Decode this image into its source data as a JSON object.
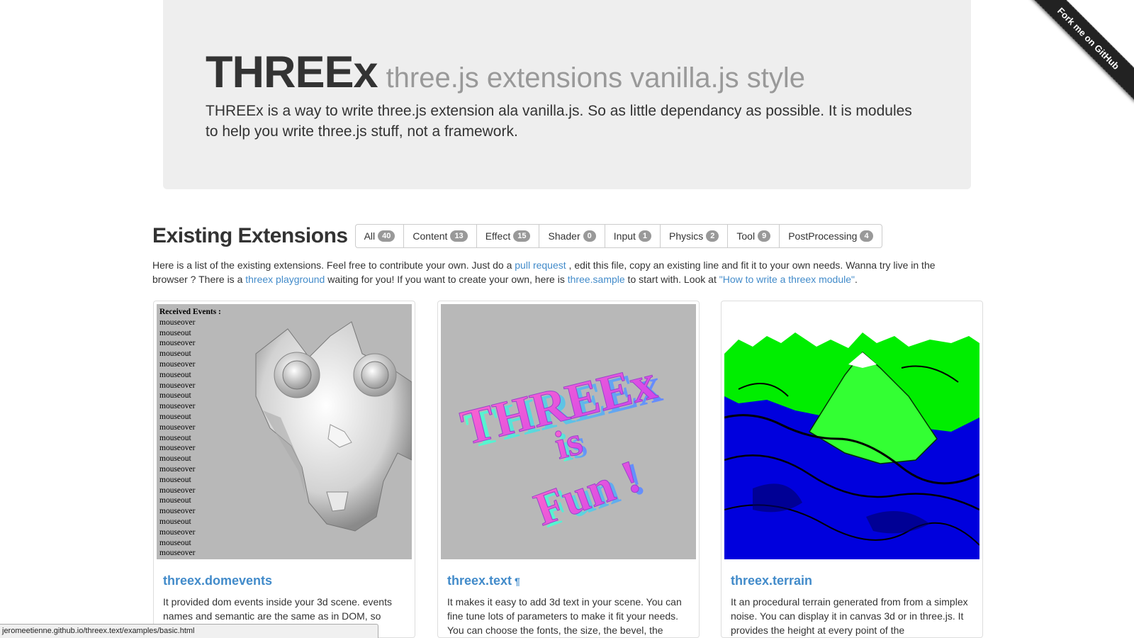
{
  "ribbon": {
    "label": "Fork me on GitHub"
  },
  "jumbotron": {
    "title": "THREEx",
    "subtitle": "three.js extensions vanilla.js style",
    "lead": "THREEx is a way to write three.js extension ala vanilla.js. So as little dependancy as possible. It is modules to help you write three.js stuff, not a framework."
  },
  "extensions": {
    "heading": "Existing Extensions",
    "filters": [
      {
        "label": "All",
        "count": "40"
      },
      {
        "label": "Content",
        "count": "13"
      },
      {
        "label": "Effect",
        "count": "15"
      },
      {
        "label": "Shader",
        "count": "0"
      },
      {
        "label": "Input",
        "count": "1"
      },
      {
        "label": "Physics",
        "count": "2"
      },
      {
        "label": "Tool",
        "count": "9"
      },
      {
        "label": "PostProcessing",
        "count": "4"
      }
    ],
    "intro": {
      "t1": "Here is a list of the existing extensions. Feel free to contribute your own. Just do a ",
      "link_pull": "pull request",
      "t2": " , edit this file, copy an existing line and fit it to your own needs. Wanna try live in the browser ? There is a ",
      "link_playground": "threex playground",
      "t3": " waiting for you! If you want to create your own, here is ",
      "link_sample": "three.sample",
      "t4": " to start with. Look at ",
      "link_howto": "\"How to write a threex module\"",
      "t5": "."
    }
  },
  "cards": [
    {
      "title": "threex.domevents",
      "description": "It provided dom events inside your 3d scene. events names and semantic are the same as in DOM, so"
    },
    {
      "title": "threex.text",
      "pilcrow": "¶",
      "description": "It makes it easy to add 3d text in your scene. You can fine tune lots of parameters to make it fit your needs. You can choose the fonts, the size, the bevel, the"
    },
    {
      "title": "threex.terrain",
      "description": "It an procedural terrain generated from from a simplex noise. You can display it in canvas 3d or in three.js. It provides the height at every point of the"
    }
  ],
  "domevents_demo": {
    "header": "Received Events :",
    "events": [
      "mouseover",
      "mouseout",
      "mouseover",
      "mouseout",
      "mouseover",
      "mouseout",
      "mouseover",
      "mouseout",
      "mouseover",
      "mouseout",
      "mouseover",
      "mouseout",
      "mouseover",
      "mouseout",
      "mouseover",
      "mouseout",
      "mouseover",
      "mouseout",
      "mouseover",
      "mouseout",
      "mouseover",
      "mouseout",
      "mouseover"
    ]
  },
  "text_demo": {
    "line1": "THREEx",
    "line2": "is",
    "line3": "Fun !"
  },
  "statusbar": {
    "url": "jeromeetienne.github.io/threex.text/examples/basic.html"
  },
  "colors": {
    "link": "#428bca",
    "badge": "#999999",
    "jumbotron_bg": "#eeeeee",
    "terrain_green": "#00ff00",
    "terrain_blue": "#0000ee"
  }
}
